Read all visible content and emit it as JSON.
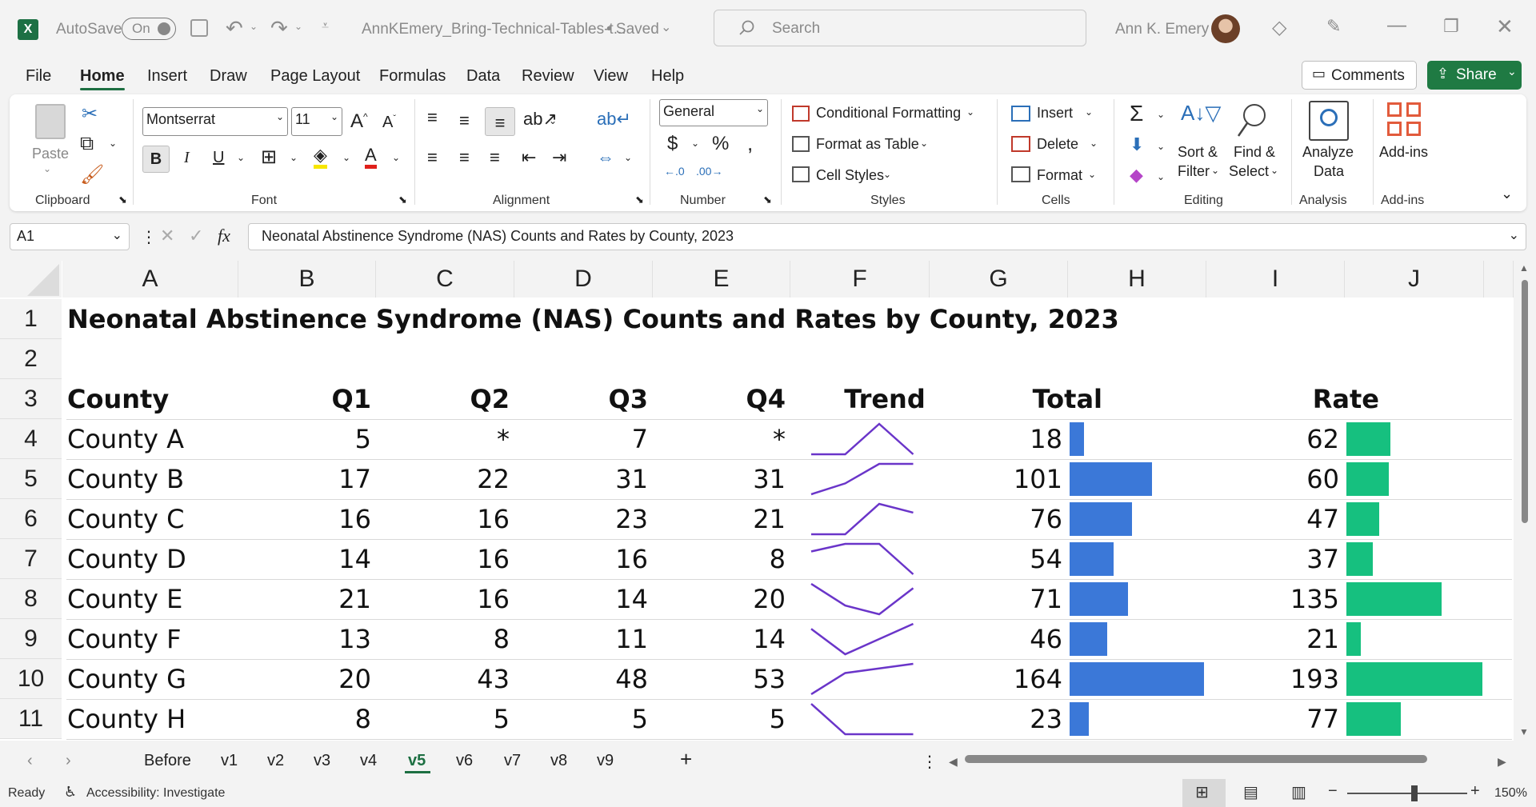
{
  "titlebar": {
    "autosave_label": "AutoSave",
    "autosave_state": "On",
    "filename": "AnnKEmery_Bring-Technical-Tables-t...",
    "save_status": "• Saved",
    "search_placeholder": "Search",
    "user_name": "Ann K. Emery"
  },
  "menu": {
    "items": [
      "File",
      "Home",
      "Insert",
      "Draw",
      "Page Layout",
      "Formulas",
      "Data",
      "Review",
      "View",
      "Help"
    ],
    "active": "Home",
    "comments_label": "Comments",
    "share_label": "Share"
  },
  "ribbon": {
    "clipboard": {
      "paste": "Paste",
      "group": "Clipboard"
    },
    "font": {
      "name": "Montserrat",
      "size": "11",
      "group": "Font"
    },
    "alignment": {
      "group": "Alignment"
    },
    "number": {
      "format": "General",
      "group": "Number"
    },
    "styles": {
      "conditional": "Conditional Formatting",
      "format_table": "Format as Table",
      "cell_styles": "Cell Styles",
      "group": "Styles"
    },
    "cells": {
      "insert": "Insert",
      "delete": "Delete",
      "format": "Format",
      "group": "Cells"
    },
    "editing": {
      "sort_line1": "Sort &",
      "sort_line2": "Filter",
      "find_line1": "Find &",
      "find_line2": "Select",
      "group": "Editing"
    },
    "analysis": {
      "line1": "Analyze",
      "line2": "Data",
      "group": "Analysis"
    },
    "addins": {
      "label": "Add-ins",
      "group": "Add-ins"
    }
  },
  "formula_bar": {
    "cell_ref": "A1",
    "fx": "fx",
    "content": "Neonatal Abstinence Syndrome (NAS) Counts and Rates by County, 2023"
  },
  "columns": [
    "A",
    "B",
    "C",
    "D",
    "E",
    "F",
    "G",
    "H",
    "I",
    "J"
  ],
  "rows": [
    "1",
    "2",
    "3",
    "4",
    "5",
    "6",
    "7",
    "8",
    "9",
    "10",
    "11"
  ],
  "sheet": {
    "title": "Neonatal Abstinence Syndrome (NAS) Counts and Rates by County, 2023",
    "headers": {
      "county": "County",
      "q1": "Q1",
      "q2": "Q2",
      "q3": "Q3",
      "q4": "Q4",
      "trend": "Trend",
      "total": "Total",
      "rate": "Rate"
    },
    "data_rows": [
      {
        "county": "County A",
        "q1": "5",
        "q2": "*",
        "q3": "7",
        "q4": "*",
        "total": "18",
        "rate": "62"
      },
      {
        "county": "County B",
        "q1": "17",
        "q2": "22",
        "q3": "31",
        "q4": "31",
        "total": "101",
        "rate": "60"
      },
      {
        "county": "County C",
        "q1": "16",
        "q2": "16",
        "q3": "23",
        "q4": "21",
        "total": "76",
        "rate": "47"
      },
      {
        "county": "County D",
        "q1": "14",
        "q2": "16",
        "q3": "16",
        "q4": "8",
        "total": "54",
        "rate": "37"
      },
      {
        "county": "County E",
        "q1": "21",
        "q2": "16",
        "q3": "14",
        "q4": "20",
        "total": "71",
        "rate": "135"
      },
      {
        "county": "County F",
        "q1": "13",
        "q2": "8",
        "q3": "11",
        "q4": "14",
        "total": "46",
        "rate": "21"
      },
      {
        "county": "County G",
        "q1": "20",
        "q2": "43",
        "q3": "48",
        "q4": "53",
        "total": "164",
        "rate": "193"
      },
      {
        "county": "County H",
        "q1": "8",
        "q2": "5",
        "q3": "5",
        "q4": "5",
        "total": "23",
        "rate": "77"
      }
    ],
    "total_bar_max": 164,
    "rate_bar_max": 193,
    "colors": {
      "sparkline": "#6a35c9",
      "total_bar": "#3b78d8",
      "rate_bar": "#16c07f",
      "accent": "#1d6f42"
    }
  },
  "sheet_tabs": {
    "tabs": [
      "Before",
      "v1",
      "v2",
      "v3",
      "v4",
      "v5",
      "v6",
      "v7",
      "v8",
      "v9"
    ],
    "active": "v5"
  },
  "status": {
    "ready": "Ready",
    "accessibility": "Accessibility: Investigate",
    "zoom": "150%"
  }
}
